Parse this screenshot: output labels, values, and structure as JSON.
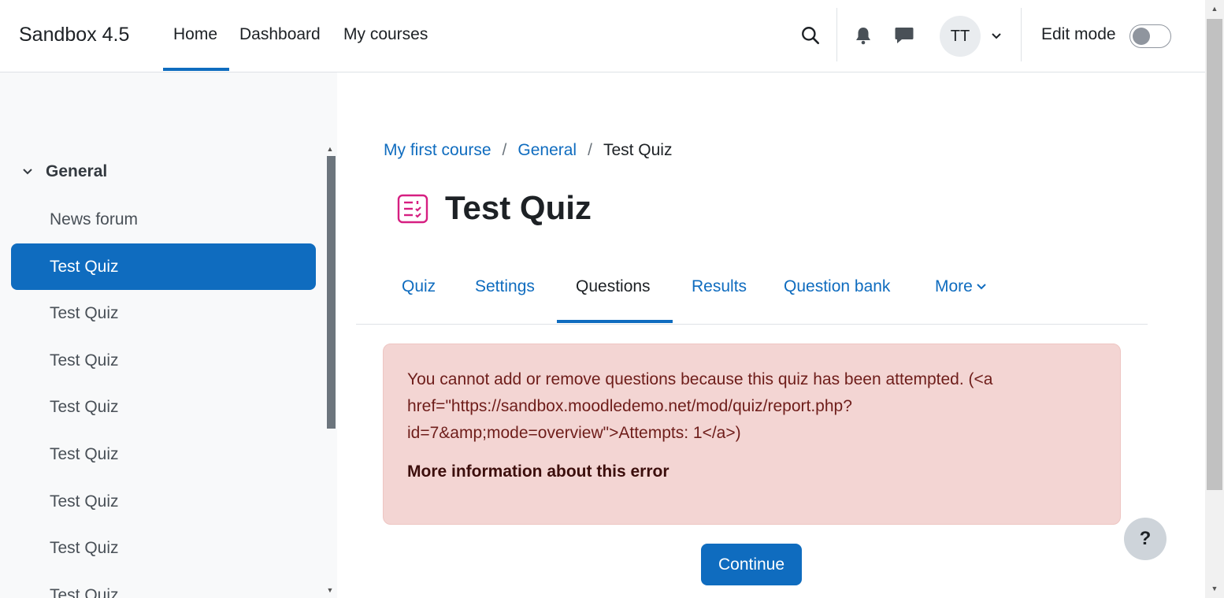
{
  "navbar": {
    "brand": "Sandbox 4.5",
    "links": [
      "Home",
      "Dashboard",
      "My courses"
    ],
    "active_link": "Home",
    "avatar_initials": "TT",
    "edit_mode_label": "Edit mode",
    "edit_mode_on": false
  },
  "drawer": {
    "section_title": "General",
    "items": [
      {
        "label": "News forum",
        "active": false
      },
      {
        "label": "Test Quiz",
        "active": true
      },
      {
        "label": "Test Quiz",
        "active": false
      },
      {
        "label": "Test Quiz",
        "active": false
      },
      {
        "label": "Test Quiz",
        "active": false
      },
      {
        "label": "Test Quiz",
        "active": false
      },
      {
        "label": "Test Quiz",
        "active": false
      },
      {
        "label": "Test Quiz",
        "active": false
      },
      {
        "label": "Test Quiz",
        "active": false
      }
    ]
  },
  "breadcrumb": {
    "items": [
      "My first course",
      "General"
    ],
    "current": "Test Quiz",
    "separator": "/"
  },
  "page": {
    "title": "Test Quiz"
  },
  "tabs": {
    "items": [
      "Quiz",
      "Settings",
      "Questions",
      "Results",
      "Question bank",
      "More"
    ],
    "active": "Questions"
  },
  "alert": {
    "message": "You cannot add or remove questions because this quiz has been attempted. (<a href=\"https://sandbox.moodledemo.net/mod/quiz/report.php?id=7&amp;mode=overview\">Attempts: 1</a>)",
    "more_info": "More information about this error"
  },
  "actions": {
    "continue_label": "Continue",
    "help_label": "?"
  },
  "colors": {
    "primary": "#0f6cbf",
    "alert_bg": "#f3d5d3",
    "alert_text": "#6e1d1a",
    "quiz_icon": "#d61f81",
    "drawer_bg": "#f8f9fa"
  }
}
